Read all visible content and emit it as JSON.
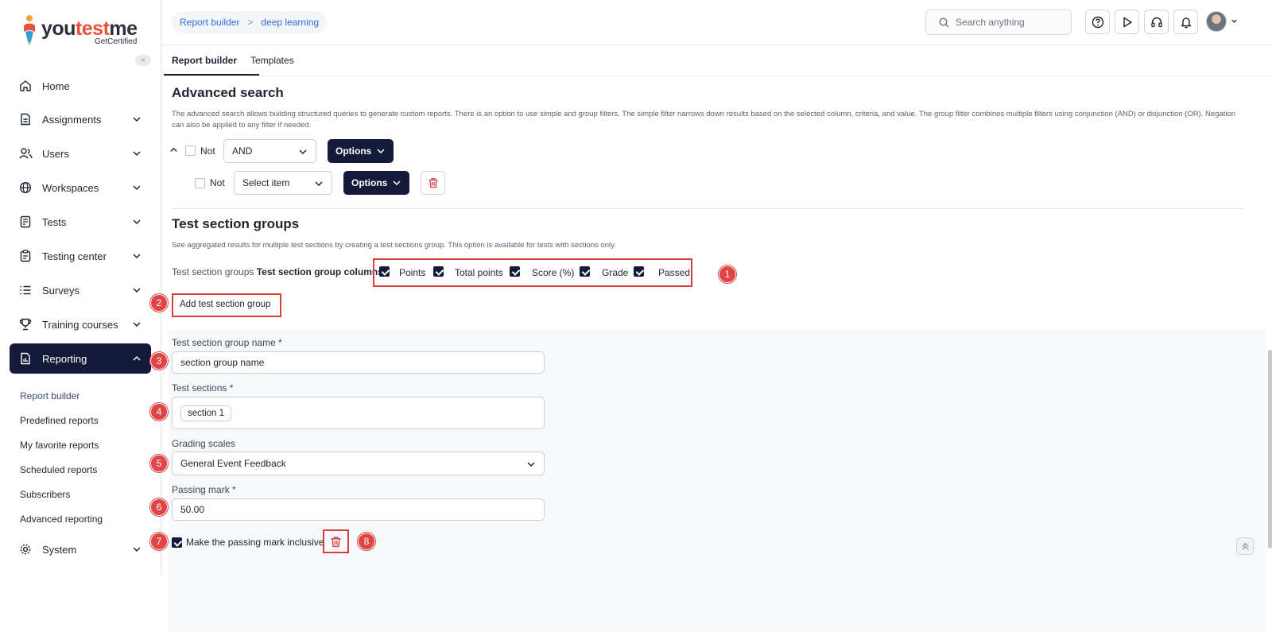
{
  "brand": {
    "name_part1": "you",
    "name_part2": "test",
    "name_part3": "me",
    "tagline": "GetCertified"
  },
  "sidebar": {
    "collapse_glyph": "«",
    "items": [
      {
        "label": "Home",
        "icon": "home-icon"
      },
      {
        "label": "Assignments",
        "icon": "document-icon"
      },
      {
        "label": "Users",
        "icon": "users-icon"
      },
      {
        "label": "Workspaces",
        "icon": "globe-icon"
      },
      {
        "label": "Tests",
        "icon": "test-icon"
      },
      {
        "label": "Testing center",
        "icon": "clipboard-icon"
      },
      {
        "label": "Surveys",
        "icon": "list-icon"
      },
      {
        "label": "Training courses",
        "icon": "trophy-icon"
      },
      {
        "label": "Reporting",
        "icon": "report-icon"
      },
      {
        "label": "System",
        "icon": "gear-icon"
      }
    ],
    "reporting_sub": [
      "Report builder",
      "Predefined reports",
      "My favorite reports",
      "Scheduled reports",
      "Subscribers",
      "Advanced reporting"
    ]
  },
  "header": {
    "breadcrumb": [
      "Report builder",
      "deep learning"
    ],
    "breadcrumb_sep": ">",
    "search_placeholder": "Search anything"
  },
  "tabs": [
    "Report builder",
    "Templates"
  ],
  "advanced_search": {
    "title": "Advanced search",
    "description": "The advanced search allows building structured queries to generate custom reports. There is an option to use simple and group filters. The simple filter narrows down results based on the selected column, criteria, and value. The group filter combines multiple filters using conjunction (AND) or disjunction (OR). Negation can also be applied to any filter if needed.",
    "group": {
      "not_label": "Not",
      "operator": "AND",
      "options_label": "Options"
    },
    "filter": {
      "not_label": "Not",
      "select_placeholder": "Select item",
      "options_label": "Options"
    }
  },
  "test_section_groups": {
    "title": "Test section groups",
    "description": "See aggregated results for multiple test sections by creating a test sections group. This option is available for tests with sections only.",
    "columns_prefix": "Test section groups",
    "columns_label": "Test section group columns",
    "columns": [
      {
        "label": "Points",
        "checked": true
      },
      {
        "label": "Total points",
        "checked": true
      },
      {
        "label": "Score (%)",
        "checked": true
      },
      {
        "label": "Grade",
        "checked": true
      },
      {
        "label": "Passed",
        "checked": true
      }
    ],
    "add_button": "Add test section group",
    "form": {
      "name_label": "Test section group name",
      "name_value": "section group name",
      "sections_label": "Test sections",
      "sections": [
        "section 1"
      ],
      "grading_label": "Grading scales",
      "grading_value": "General Event Feedback",
      "passing_label": "Passing mark",
      "passing_value": "50.00",
      "inclusive_label": "Make the passing mark inclusive",
      "inclusive_checked": true,
      "required_mark": "*"
    }
  },
  "markers": [
    "1",
    "2",
    "3",
    "4",
    "5",
    "6",
    "7",
    "8"
  ],
  "colors": {
    "primary": "#141b3a",
    "link": "#2f6fd6",
    "danger": "#dc3b3b",
    "marker": "#e04444"
  }
}
